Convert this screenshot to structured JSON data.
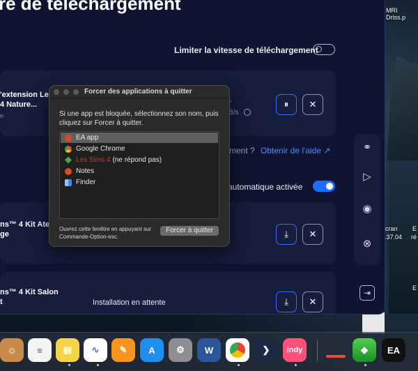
{
  "ea_app": {
    "page_title": "re de téléchargement",
    "limit_label": "Limiter la vitesse de téléchargement",
    "card1_title": "'extension Le\n4 Nature...",
    "card1_sub": "n",
    "card1_speed": "B/s",
    "pause_glyph": "⏸",
    "help_question": "ment ?",
    "help_link": "Obtenir de l'aide ↗",
    "auto_update": "automatique activée",
    "card2_title": "ns™ 4 Kit Atel\nge",
    "card3_title": "ns™ 4 Kit Salon\nt",
    "pending_status": "Installation en attente",
    "close_glyph": "✕",
    "download_glyph": "⤓",
    "exit_glyph": "⇥"
  },
  "desktop": {
    "top_file": "MRI Driss.p",
    "label_ecran": "écran",
    "label_time": ".37.04",
    "label_e1": "E",
    "label_re": "ré",
    "label_e2": "E"
  },
  "dialog": {
    "title": "Forcer des applications à quitter",
    "message": "Si une app est bloquée, sélectionnez son nom, puis cliquez sur Forcer à quitter.",
    "apps": [
      {
        "name": "EA app",
        "selected": true,
        "not_responding": false,
        "color": "#d94a24"
      },
      {
        "name": "Google Chrome",
        "selected": false,
        "not_responding": false,
        "color": "#4285f4"
      },
      {
        "name": "Les Sims 4",
        "selected": false,
        "not_responding": true,
        "tail": "(ne répond pas)",
        "color": "#3fae3f"
      },
      {
        "name": "Notes",
        "selected": false,
        "not_responding": false,
        "color": "#d94a24"
      },
      {
        "name": "Finder",
        "selected": false,
        "not_responding": false,
        "color": "#3f8cf0"
      }
    ],
    "hint": "Ouvrez cette fenêtre en appuyant sur Commande-Option-esc.",
    "quit_button": "Forcer à quitter"
  },
  "rail_icons": [
    "link-icon",
    "playstation-icon",
    "steam-icon",
    "xbox-icon"
  ],
  "dock": {
    "word_letter": "W",
    "indy_label": "indy",
    "ea_label": "EA"
  }
}
